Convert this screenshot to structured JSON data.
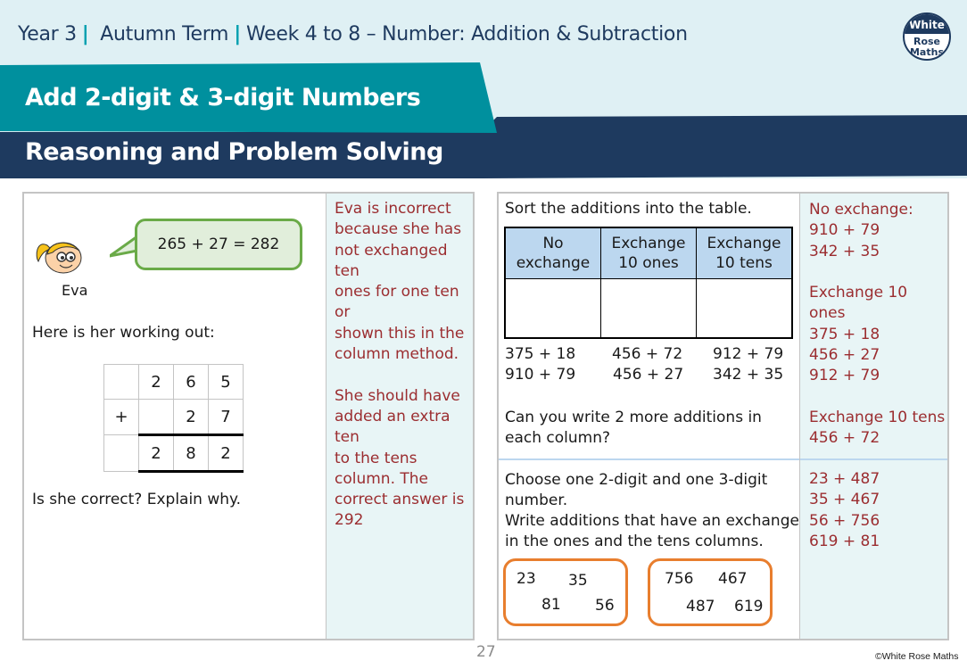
{
  "header": {
    "breadcrumb": {
      "year": "Year 3",
      "term": "Autumn Term",
      "unit": "Week 4 to 8 – Number: Addition & Subtraction"
    },
    "title": "Add 2-digit & 3-digit Numbers",
    "subtitle": "Reasoning and Problem Solving",
    "logo": {
      "line1": "White",
      "line2": "Rose",
      "line3": "Maths"
    }
  },
  "colors": {
    "navy": "#1e3a5f",
    "teal": "#00909e",
    "light_band": "#dff0f4",
    "answer_red": "#9b2d30",
    "answer_bg": "#e8f5f6",
    "table_header": "#bcd7ef",
    "bubble_green": "#6aaa48",
    "box_orange": "#e87e2e"
  },
  "left_panel": {
    "character_name": "Eva",
    "speech": "265 + 27 = 282",
    "intro": "Here is her working out:",
    "column_method": {
      "rows": [
        [
          "",
          "2",
          "6",
          "5"
        ],
        [
          "+",
          "",
          "2",
          "7"
        ],
        [
          "",
          "2",
          "8",
          "2"
        ]
      ]
    },
    "question": "Is she correct? Explain why.",
    "answer": "Eva is incorrect\nbecause she has\nnot exchanged ten\nones for one ten or\nshown this in the\ncolumn method.\n\nShe should have\nadded an extra ten\nto the tens\ncolumn. The\ncorrect answer is\n292"
  },
  "right_panel": {
    "q1": {
      "prompt": "Sort the additions into the table.",
      "table_headers": [
        {
          "line1": "No",
          "line2": "exchange"
        },
        {
          "line1": "Exchange",
          "line2": "10 ones"
        },
        {
          "line1": "Exchange",
          "line2": "10 tens"
        }
      ],
      "additions": [
        [
          "375 + 18",
          "456 + 72",
          "912 + 79"
        ],
        [
          "910 + 79",
          "456 + 27",
          "342 + 35"
        ]
      ],
      "followup": "Can you write 2 more additions in each column?",
      "answer": "No exchange:\n910 + 79\n342 + 35\n\nExchange 10 ones\n375 + 18\n456 + 27\n912 + 79\n\nExchange 10 tens\n456 + 72"
    },
    "q2": {
      "prompt_line1": "Choose one 2-digit and one 3-digit number.",
      "prompt_line2": "Write additions that have an exchange in the ones and the tens columns.",
      "box_2digit": [
        "23",
        "35",
        "81",
        "56"
      ],
      "box_3digit": [
        "756",
        "467",
        "487",
        "619"
      ],
      "answer": "23 + 487\n35 + 467\n56 + 756\n619 + 81"
    }
  },
  "footer": {
    "page_number": "27",
    "copyright": "©White Rose Maths"
  }
}
